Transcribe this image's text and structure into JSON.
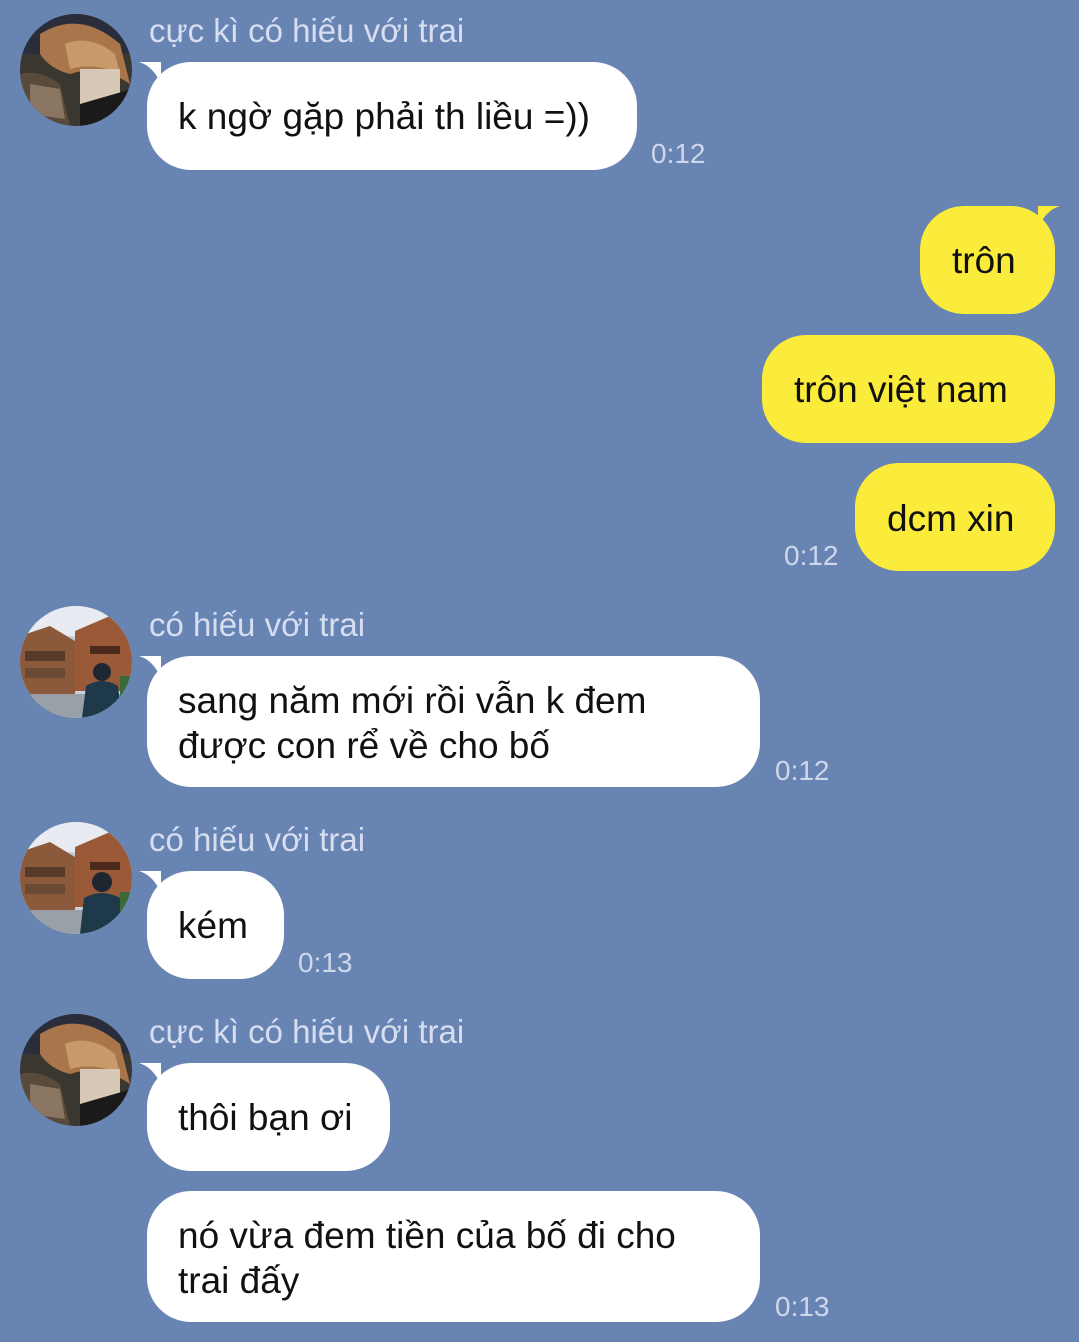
{
  "messages": [
    {
      "sender": "cực kì có hiếu với trai",
      "text": "k ngờ gặp phải th liều =))",
      "time": "0:12",
      "avatar": "avatar-a"
    },
    {
      "text": "trôn",
      "direction": "out"
    },
    {
      "text": "trôn việt nam",
      "direction": "out"
    },
    {
      "text": "dcm xin",
      "direction": "out",
      "time": "0:12"
    },
    {
      "sender": "có hiếu với trai",
      "text": "sang năm mới rồi vẫn k đem được con rể về cho bố",
      "time": "0:12",
      "avatar": "avatar-b"
    },
    {
      "sender": "có hiếu với trai",
      "text": "kém",
      "time": "0:13",
      "avatar": "avatar-b"
    },
    {
      "sender": "cực kì có hiếu với trai",
      "text": "thôi bạn ơi",
      "avatar": "avatar-a"
    },
    {
      "text": "nó vừa đem tiền của bố đi cho trai đấy",
      "time": "0:13"
    }
  ],
  "colors": {
    "background": "#6884b3",
    "incoming_bubble": "#ffffff",
    "outgoing_bubble": "#fbeb3a",
    "sender_name": "#d6def0",
    "timestamp": "#cfd8ea"
  }
}
